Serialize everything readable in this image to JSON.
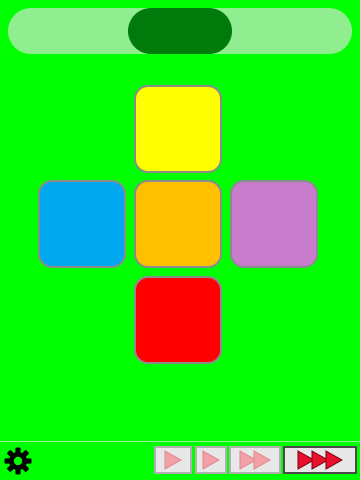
{
  "colors": {
    "background": "#00ff00",
    "top_bar": "#90ee90",
    "top_pill": "#007a0a",
    "bottom_line": "#b8f0b8",
    "gear": "#000000",
    "play_light": "#f4a0a8",
    "play_strong": "#e8102a"
  },
  "tiles": {
    "top": {
      "color": "#ffff00",
      "name": "yellow"
    },
    "left": {
      "color": "#00a8f0",
      "name": "blue"
    },
    "center": {
      "color": "#ffc000",
      "name": "orange"
    },
    "right": {
      "color": "#c87ccc",
      "name": "purple"
    },
    "bottom": {
      "color": "#ff0000",
      "name": "red"
    }
  },
  "toolbar": {
    "settings_icon": "gear-icon",
    "speed_options": [
      {
        "arrows": 1,
        "selected": false
      },
      {
        "arrows": 1,
        "selected": false
      },
      {
        "arrows": 2,
        "selected": false
      },
      {
        "arrows": 3,
        "selected": true
      }
    ]
  }
}
